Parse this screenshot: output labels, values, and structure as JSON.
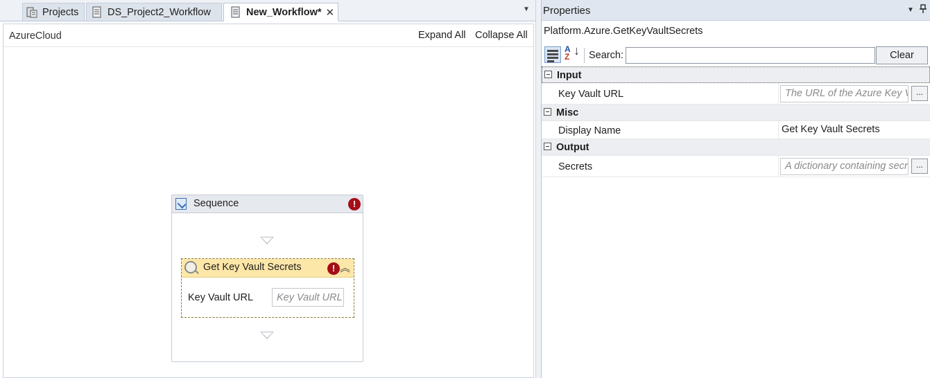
{
  "tabs": [
    {
      "label": "Projects",
      "active": false,
      "icon": "projects-icon"
    },
    {
      "label": "DS_Project2_Workflow",
      "active": false,
      "icon": "workflow-doc-icon"
    },
    {
      "label": "New_Workflow*",
      "active": true,
      "icon": "workflow-doc-icon",
      "close": "✕"
    }
  ],
  "designer": {
    "breadcrumb": "AzureCloud",
    "expand_all": "Expand All",
    "collapse_all": "Collapse All",
    "sequence": {
      "title": "Sequence",
      "error_glyph": "!",
      "activity": {
        "title": "Get Key Vault Secrets",
        "error_glyph": "!",
        "collapse_glyph": "︽",
        "field_label": "Key Vault URL",
        "field_placeholder": "Key Vault URL"
      }
    }
  },
  "properties": {
    "title": "Properties",
    "menu_glyph": "▼",
    "pin_glyph": "📌",
    "type_name": "Platform.Azure.GetKeyVaultSecrets",
    "search_label": "Search:",
    "search_value": "",
    "clear_label": "Clear",
    "sort_alpha_top": "A",
    "sort_alpha_bottom": "Z",
    "categories": [
      {
        "name": "Input",
        "rows": [
          {
            "label": "Key Vault URL",
            "placeholder": "The URL of the Azure Key Vault",
            "has_button": true,
            "button": "..."
          }
        ]
      },
      {
        "name": "Misc",
        "rows": [
          {
            "label": "Display Name",
            "value": "Get Key Vault Secrets",
            "has_button": false
          }
        ]
      },
      {
        "name": "Output",
        "rows": [
          {
            "label": "Secrets",
            "placeholder": "A dictionary containing secrets",
            "has_button": true,
            "button": "..."
          }
        ]
      }
    ]
  },
  "colors": {
    "accent": "#3a6fb0",
    "error": "#a40e17",
    "activity_header": "#fde7a8"
  }
}
